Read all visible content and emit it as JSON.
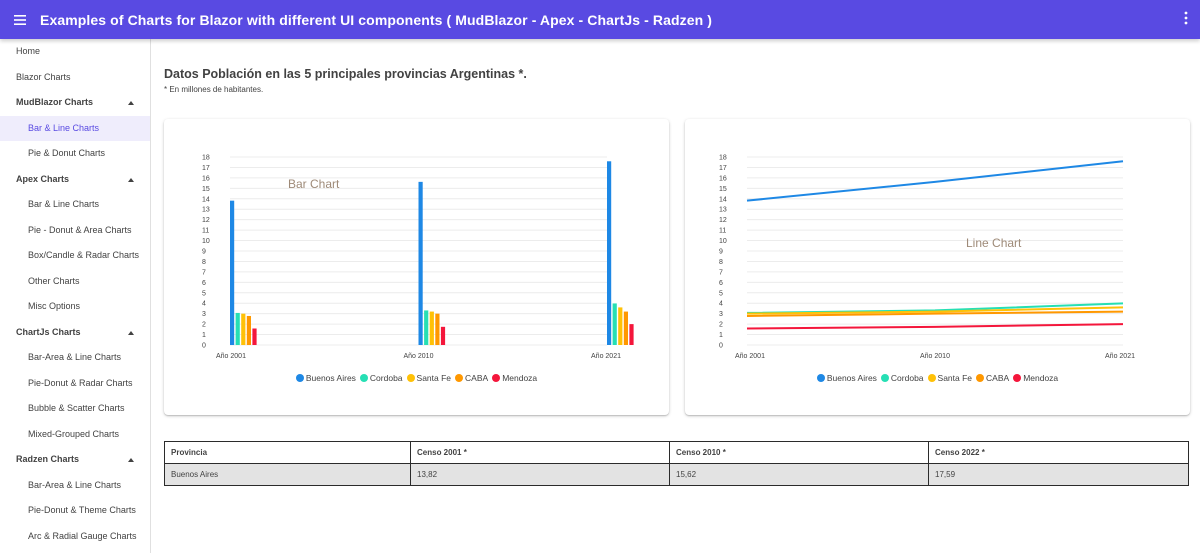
{
  "appbar": {
    "title": "Examples of Charts for Blazor with different UI components ( MudBlazor - Apex - ChartJs - Radzen )"
  },
  "sidebar": {
    "items": [
      {
        "label": "Home",
        "kind": "item"
      },
      {
        "label": "Blazor Charts",
        "kind": "item"
      },
      {
        "label": "MudBlazor Charts",
        "kind": "group"
      },
      {
        "label": "Bar & Line Charts",
        "kind": "sub",
        "active": true
      },
      {
        "label": "Pie & Donut Charts",
        "kind": "sub"
      },
      {
        "label": "Apex Charts",
        "kind": "group"
      },
      {
        "label": "Bar & Line Charts",
        "kind": "sub"
      },
      {
        "label": "Pie - Donut & Area Charts",
        "kind": "sub"
      },
      {
        "label": "Box/Candle & Radar Charts",
        "kind": "sub"
      },
      {
        "label": "Other Charts",
        "kind": "sub"
      },
      {
        "label": "Misc Options",
        "kind": "sub"
      },
      {
        "label": "ChartJs Charts",
        "kind": "group"
      },
      {
        "label": "Bar-Area & Line Charts",
        "kind": "sub"
      },
      {
        "label": "Pie-Donut & Radar Charts",
        "kind": "sub"
      },
      {
        "label": "Bubble & Scatter Charts",
        "kind": "sub"
      },
      {
        "label": "Mixed-Grouped Charts",
        "kind": "sub"
      },
      {
        "label": "Radzen Charts",
        "kind": "group"
      },
      {
        "label": "Bar-Area & Line Charts",
        "kind": "sub"
      },
      {
        "label": "Pie-Donut & Theme Charts",
        "kind": "sub"
      },
      {
        "label": "Arc & Radial Gauge Charts",
        "kind": "sub"
      }
    ]
  },
  "main": {
    "title": "Datos Población en las 5 principales provincias Argentinas *.",
    "note": "* En millones de habitantes."
  },
  "chart_data": [
    {
      "type": "bar",
      "overlay_label": "Bar Chart",
      "categories": [
        "Año 2001",
        "Año 2010",
        "Año 2021"
      ],
      "yticks": [
        0,
        1,
        2,
        3,
        4,
        5,
        6,
        7,
        8,
        9,
        10,
        11,
        12,
        13,
        14,
        15,
        16,
        17,
        18
      ],
      "ylim": [
        0,
        18
      ],
      "grid": true,
      "legend_position": "bottom",
      "series": [
        {
          "name": "Buenos Aires",
          "color": "#1e88e5",
          "values": [
            13.82,
            15.62,
            17.59
          ]
        },
        {
          "name": "Cordoba",
          "color": "#26dfb4",
          "values": [
            3.07,
            3.31,
            3.98
          ]
        },
        {
          "name": "Santa Fe",
          "color": "#ffc107",
          "values": [
            3.0,
            3.2,
            3.6
          ]
        },
        {
          "name": "CABA",
          "color": "#ff9800",
          "values": [
            2.78,
            3.0,
            3.2
          ]
        },
        {
          "name": "Mendoza",
          "color": "#f4163b",
          "values": [
            1.58,
            1.74,
            2.0
          ]
        }
      ]
    },
    {
      "type": "line",
      "overlay_label": "Line Chart",
      "categories": [
        "Año 2001",
        "Año 2010",
        "Año 2021"
      ],
      "yticks": [
        0,
        1,
        2,
        3,
        4,
        5,
        6,
        7,
        8,
        9,
        10,
        11,
        12,
        13,
        14,
        15,
        16,
        17,
        18
      ],
      "ylim": [
        0,
        18
      ],
      "grid": true,
      "legend_position": "bottom",
      "series": [
        {
          "name": "Buenos Aires",
          "color": "#1e88e5",
          "values": [
            13.82,
            15.62,
            17.59
          ]
        },
        {
          "name": "Cordoba",
          "color": "#26dfb4",
          "values": [
            3.07,
            3.31,
            3.98
          ]
        },
        {
          "name": "Santa Fe",
          "color": "#ffc107",
          "values": [
            3.0,
            3.2,
            3.6
          ]
        },
        {
          "name": "CABA",
          "color": "#ff9800",
          "values": [
            2.78,
            3.0,
            3.2
          ]
        },
        {
          "name": "Mendoza",
          "color": "#f4163b",
          "values": [
            1.58,
            1.74,
            2.0
          ]
        }
      ]
    }
  ],
  "table": {
    "headers": [
      "Provincia",
      "Censo 2001 *",
      "Censo 2010 *",
      "Censo 2022 *"
    ],
    "rows": [
      [
        "Buenos Aires",
        "13,82",
        "15,62",
        "17,59"
      ]
    ]
  }
}
